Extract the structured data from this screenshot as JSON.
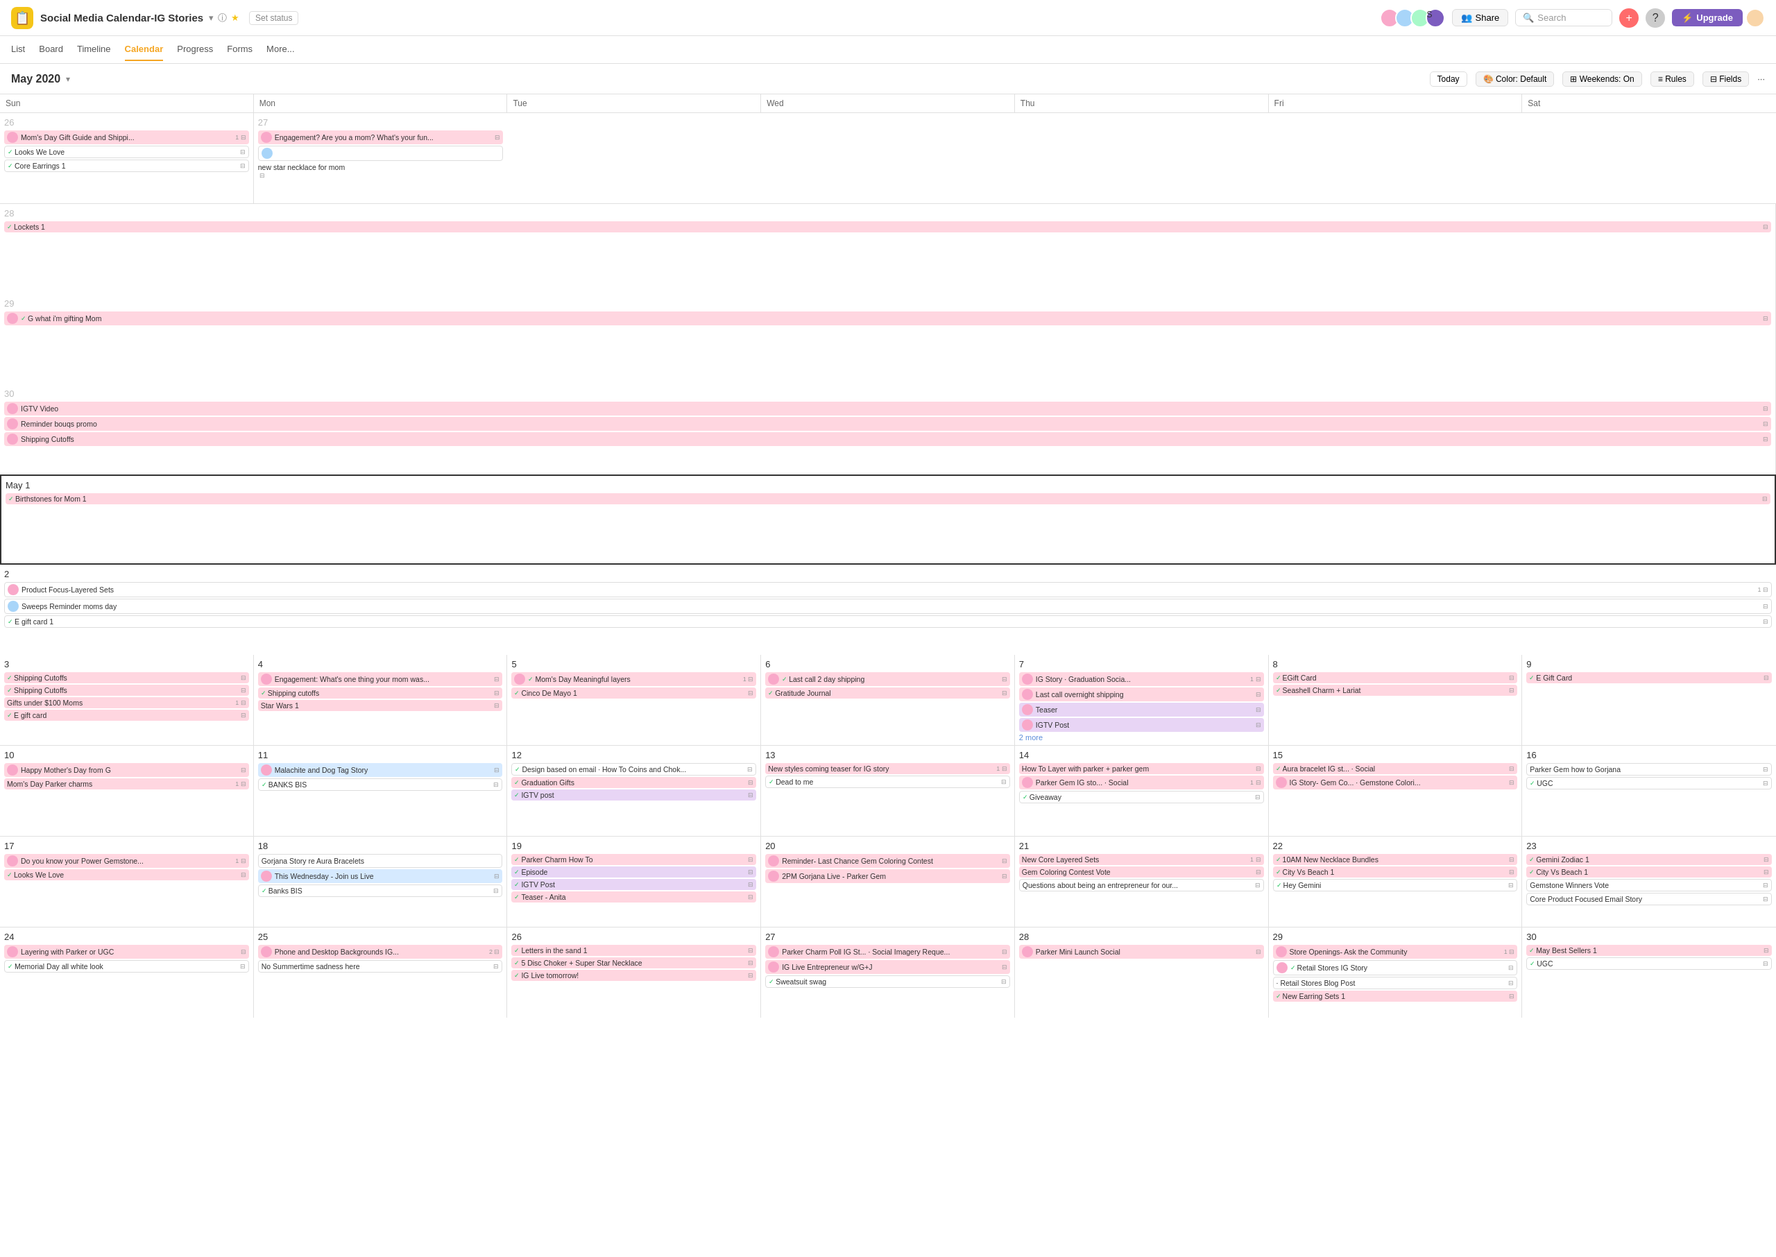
{
  "app": {
    "icon": "📋",
    "title": "Social Media Calendar-IG Stories",
    "status": "Set status"
  },
  "subnav": {
    "items": [
      "List",
      "Board",
      "Timeline",
      "Calendar",
      "Progress",
      "Forms",
      "More..."
    ],
    "active": "Calendar"
  },
  "month": "May 2020",
  "controls": {
    "today": "Today",
    "color": "Color: Default",
    "weekends": "Weekends: On",
    "rules": "Rules",
    "fields": "Fields"
  },
  "dayHeaders": [
    "Sun",
    "Mon",
    "Tue",
    "Wed",
    "Thu",
    "Fri",
    "Sat"
  ],
  "searchPlaceholder": "Search",
  "shareLabel": "Share",
  "upgradeLabel": "Upgrade"
}
